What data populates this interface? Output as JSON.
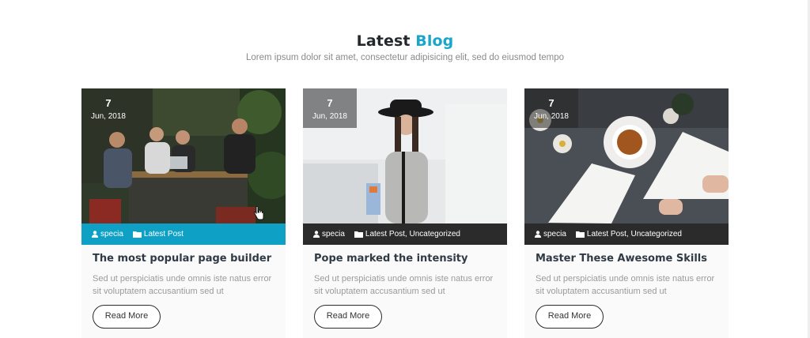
{
  "section": {
    "title_main": "Latest",
    "title_accent": "Blog",
    "subtitle": "Lorem ipsum dolor sit amet, consectetur adipisicing elit, sed do eiusmod tempo"
  },
  "colors": {
    "accent": "#1aa6c8",
    "meta_active": "#0fa0c6",
    "meta_dark": "#2b2b2b"
  },
  "posts": [
    {
      "day": "7",
      "month": "Jun, 2018",
      "author": "specia",
      "categories": "Latest Post",
      "title": "The most popular page builder",
      "excerpt": "Sed ut perspiciatis unde omnis iste natus error sit voluptatem accusantium sed ut",
      "button": "Read More"
    },
    {
      "day": "7",
      "month": "Jun, 2018",
      "author": "specia",
      "categories": "Latest Post, Uncategorized",
      "title": "Pope marked the intensity",
      "excerpt": "Sed ut perspiciatis unde omnis iste natus error sit voluptatem accusantium sed ut",
      "button": "Read More"
    },
    {
      "day": "7",
      "month": "Jun, 2018",
      "author": "specia",
      "categories": "Latest Post, Uncategorized",
      "title": "Master These Awesome Skills",
      "excerpt": "Sed ut perspiciatis unde omnis iste natus error sit voluptatem accusantium sed ut",
      "button": "Read More"
    }
  ]
}
